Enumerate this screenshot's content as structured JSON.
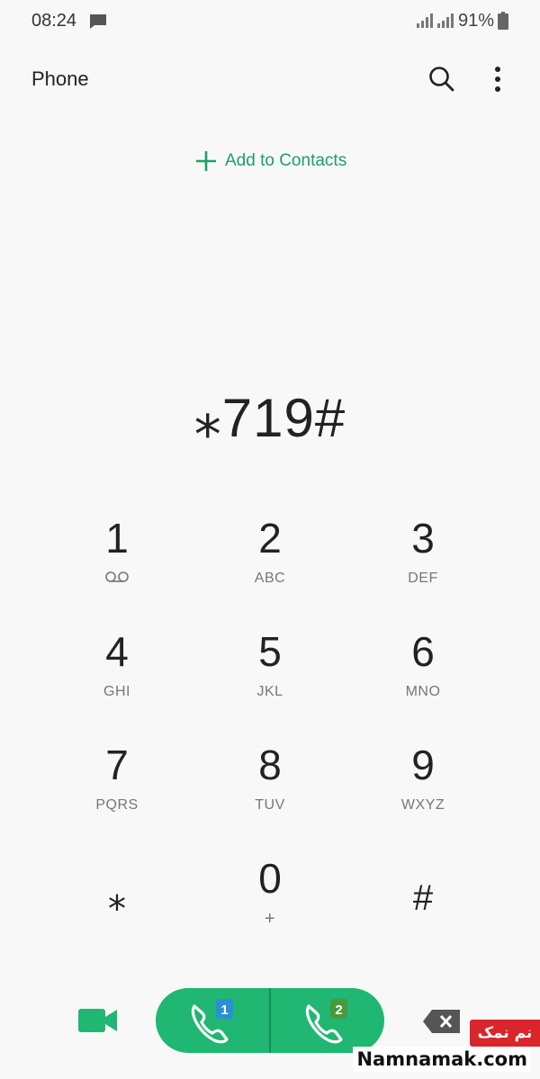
{
  "status_bar": {
    "time": "08:24",
    "battery": "91%",
    "icons": [
      "message-icon",
      "signal-sim1-icon",
      "signal-sim2-icon",
      "battery-icon"
    ]
  },
  "header": {
    "title": "Phone",
    "icons": [
      "search-icon",
      "more-vert-icon"
    ]
  },
  "add_contacts": {
    "label": "Add to Contacts",
    "icon": "plus-icon"
  },
  "dial": {
    "number": "⁎719#"
  },
  "keypad": {
    "k1": {
      "digit": "1",
      "sub_icon": "voicemail-icon"
    },
    "k2": {
      "digit": "2",
      "letters": "ABC"
    },
    "k3": {
      "digit": "3",
      "letters": "DEF"
    },
    "k4": {
      "digit": "4",
      "letters": "GHI"
    },
    "k5": {
      "digit": "5",
      "letters": "JKL"
    },
    "k6": {
      "digit": "6",
      "letters": "MNO"
    },
    "k7": {
      "digit": "7",
      "letters": "PQRS"
    },
    "k8": {
      "digit": "8",
      "letters": "TUV"
    },
    "k9": {
      "digit": "9",
      "letters": "WXYZ"
    },
    "kstar": {
      "digit": "⁎"
    },
    "k0": {
      "digit": "0",
      "letters": "+"
    },
    "khash": {
      "digit": "#"
    }
  },
  "bottom_bar": {
    "video_icon": "video-call-icon",
    "call_sim1": {
      "icon": "phone-icon",
      "sim": "1"
    },
    "call_sim2": {
      "icon": "phone-icon",
      "sim": "2"
    },
    "backspace_icon": "backspace-icon"
  },
  "watermark": {
    "logo": "نم نمک",
    "text": "Namnamak.com"
  },
  "colors": {
    "accent": "#1e9f63",
    "call_green": "#1fb772",
    "background": "#f8f8f8"
  }
}
